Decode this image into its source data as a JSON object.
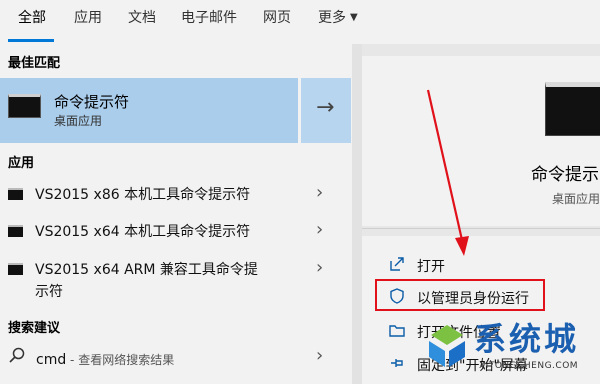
{
  "tabs": [
    {
      "label": "全部",
      "active": true
    },
    {
      "label": "应用"
    },
    {
      "label": "文档"
    },
    {
      "label": "电子邮件"
    },
    {
      "label": "网页"
    },
    {
      "label": "更多"
    }
  ],
  "sections": {
    "best_match": "最佳匹配",
    "apps": "应用",
    "search_suggestions": "搜索建议"
  },
  "best_match": {
    "title": "命令提示符",
    "subtitle": "桌面应用",
    "icon": "cmd-icon"
  },
  "apps": [
    {
      "label": "VS2015 x86 本机工具命令提示符"
    },
    {
      "label": "VS2015 x64 本机工具命令提示符"
    },
    {
      "label_line1": "VS2015 x64 ARM 兼容工具命令提",
      "label_line2": "示符"
    }
  ],
  "suggestion": {
    "query": "cmd",
    "note": " - 查看网络搜索结果"
  },
  "detail": {
    "title": "命令提示",
    "subtitle": "桌面应用"
  },
  "actions": [
    {
      "label": "打开",
      "icon": "open-icon"
    },
    {
      "label": "以管理员身份运行",
      "icon": "shield-icon",
      "highlighted": true
    },
    {
      "label": "打开文件位置",
      "icon": "folder-icon"
    },
    {
      "label": "固定到\"开始\"屏幕",
      "icon": "pin-icon"
    }
  ],
  "watermark": {
    "text": "系统城",
    "url": "XITONGCHENG.COM"
  },
  "colors": {
    "selection": "#aacdec",
    "accent": "#0078d7",
    "annotation": "#e0111a",
    "watermark": "#1b5fb0"
  }
}
